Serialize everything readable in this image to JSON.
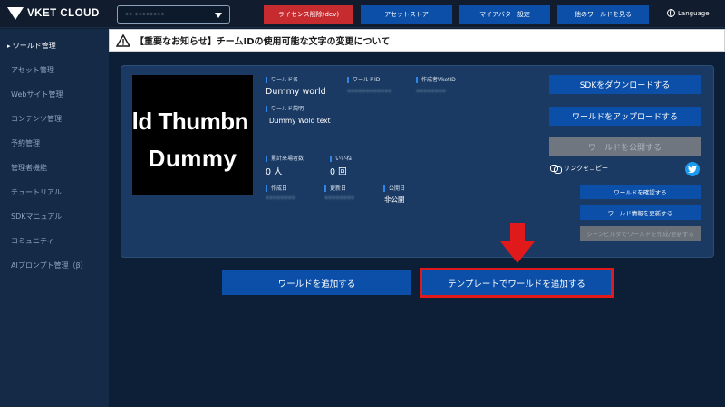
{
  "header": {
    "logo_text": "VKET CLOUD",
    "world_select_value": "•• ••••••••",
    "buttons": [
      {
        "label": "ライセンス削除(dev)",
        "color": "#c62b2f"
      },
      {
        "label": "アセットストア"
      },
      {
        "label": "マイアバター設定"
      },
      {
        "label": "他のワールドを見る"
      }
    ],
    "language_label": "Language"
  },
  "sidebar": {
    "items": [
      {
        "label": "ワールド管理",
        "active": true
      },
      {
        "label": "アセット管理"
      },
      {
        "label": "Webサイト管理"
      },
      {
        "label": "コンテンツ管理"
      },
      {
        "label": "予約管理"
      },
      {
        "label": "管理者機能"
      },
      {
        "label": "チュートリアル"
      },
      {
        "label": "SDKマニュアル"
      },
      {
        "label": "コミュニティ"
      },
      {
        "label": "AIプロンプト管理（β）"
      }
    ]
  },
  "notice": {
    "icon": "warning-icon",
    "text": "【重要なお知らせ】チームIDの使用可能な文字の変更について"
  },
  "world_card": {
    "thumbnail_line1": "rld Thumbn",
    "thumbnail_line2": "Dummy",
    "world_name_label": "ワールド名",
    "world_name": "Dummy world",
    "world_id_label": "ワールドID",
    "world_id_value": "••••••••••••",
    "creator_label": "作成者VketID",
    "creator_value": "••••••••",
    "description_label": "ワールド説明",
    "description": "Dummy Wold text",
    "visitors_label": "累計来場者数",
    "visitors_value": "0 人",
    "likes_label": "いいね",
    "likes_value": "0 回",
    "created_label": "作成日",
    "created_value": "••••••••",
    "updated_label": "更新日",
    "updated_value": "••••••••",
    "published_label": "公開日",
    "published_value": "非公開",
    "sdk_download_label": "SDKをダウンロードする",
    "upload_label": "ワールドをアップロードする",
    "publish_label": "ワールドを公開する",
    "copy_link_label": "リンクをコピー",
    "check_world_label": "ワールドを確認する",
    "update_info_label": "ワールド情報を更新する",
    "scene_builder_label": "シーンビルダでワールドを作成/更新する"
  },
  "actions": {
    "add_world_label": "ワールドを追加する",
    "add_from_template_label": "テンプレートでワールドを追加する"
  },
  "colors": {
    "accent": "#0b4fa8",
    "highlight": "#e01a1a",
    "background": "#0d1f36",
    "sidebar": "#142a47",
    "card": "#1a3a63"
  }
}
